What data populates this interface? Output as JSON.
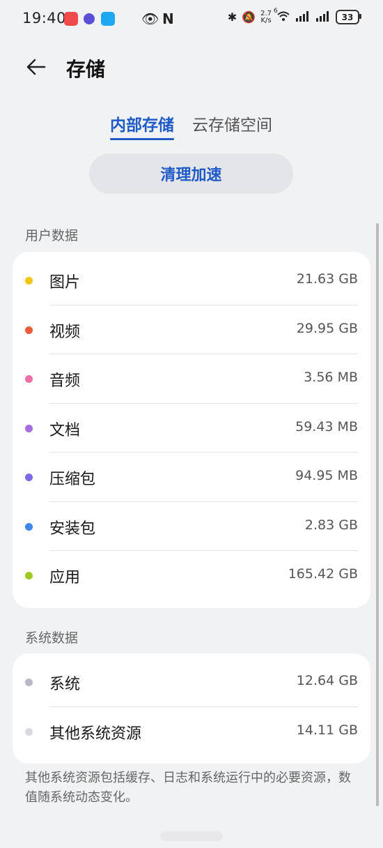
{
  "status_bar": {
    "time": "19:40",
    "network_speed_value": "2.7",
    "network_speed_unit": "K/s",
    "wifi_label": "6",
    "battery": "33"
  },
  "header": {
    "title": "存储"
  },
  "tabs": [
    {
      "label": "内部存储",
      "active": true
    },
    {
      "label": "云存储空间",
      "active": false
    }
  ],
  "clean_button": "清理加速",
  "user_data": {
    "heading": "用户数据",
    "items": [
      {
        "label": "图片",
        "value": "21.63 GB",
        "color": "#f2c40f"
      },
      {
        "label": "视频",
        "value": "29.95 GB",
        "color": "#ee5c3b"
      },
      {
        "label": "音频",
        "value": "3.56 MB",
        "color": "#ee6fa8"
      },
      {
        "label": "文档",
        "value": "59.43 MB",
        "color": "#a56ee0"
      },
      {
        "label": "压缩包",
        "value": "94.95 MB",
        "color": "#7b6be6"
      },
      {
        "label": "安装包",
        "value": "2.83 GB",
        "color": "#3e86f0"
      },
      {
        "label": "应用",
        "value": "165.42 GB",
        "color": "#9ccc1e"
      }
    ]
  },
  "system_data": {
    "heading": "系统数据",
    "items": [
      {
        "label": "系统",
        "value": "12.64 GB",
        "color": "#b9b8c4"
      },
      {
        "label": "其他系统资源",
        "value": "14.11 GB",
        "color": "#dad9e2"
      }
    ]
  },
  "footnote": "其他系统资源包括缓存、日志和系统运行中的必要资源，数值随系统动态变化。"
}
